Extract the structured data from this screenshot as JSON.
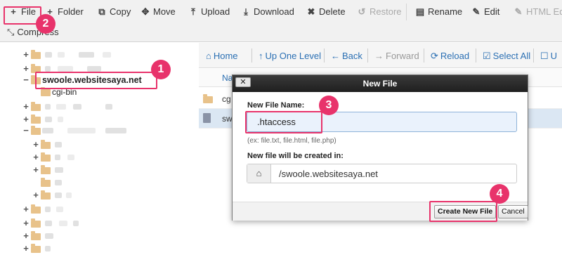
{
  "toolbar": {
    "row1": [
      {
        "label": "File",
        "icon": "plus-icon"
      },
      {
        "label": "Folder",
        "icon": "plus-icon"
      },
      {
        "label": "Copy",
        "icon": "copy-icon"
      },
      {
        "label": "Move",
        "icon": "move-icon"
      },
      {
        "label": "Upload",
        "icon": "upload-icon"
      },
      {
        "label": "Download",
        "icon": "download-icon"
      },
      {
        "label": "Delete",
        "icon": "close-icon"
      },
      {
        "label": "Restore",
        "icon": "restore-icon"
      },
      {
        "label": "Rename",
        "icon": "document-icon"
      },
      {
        "label": "Edit",
        "icon": "pencil-icon"
      },
      {
        "label": "HTML Edi",
        "icon": "html-edit-icon"
      }
    ],
    "compress_label": "Compress"
  },
  "tree": {
    "selected_folder": "swoole.websitesaya.net",
    "child_folder": "cgi-bin"
  },
  "nav": {
    "home": "Home",
    "up_one_level": "Up One Level",
    "back": "Back",
    "forward": "Forward",
    "reload": "Reload",
    "select_all": "Select All",
    "unselect": "U"
  },
  "files": {
    "header_name": "Na",
    "rows": [
      "cg",
      "sw"
    ]
  },
  "modal": {
    "title": "New File",
    "close_label": "✕",
    "name_label": "New File Name:",
    "name_value": ".htaccess",
    "hint": "(ex: file.txt, file.html, file.php)",
    "location_label": "New file will be created in:",
    "path_value": "/swoole.websitesaya.net",
    "create_button": "Create New File",
    "cancel_button": "Cancel"
  },
  "annotations": {
    "step1": "1",
    "step2": "2",
    "step3": "3",
    "step4": "4",
    "color": "#e8336b"
  }
}
